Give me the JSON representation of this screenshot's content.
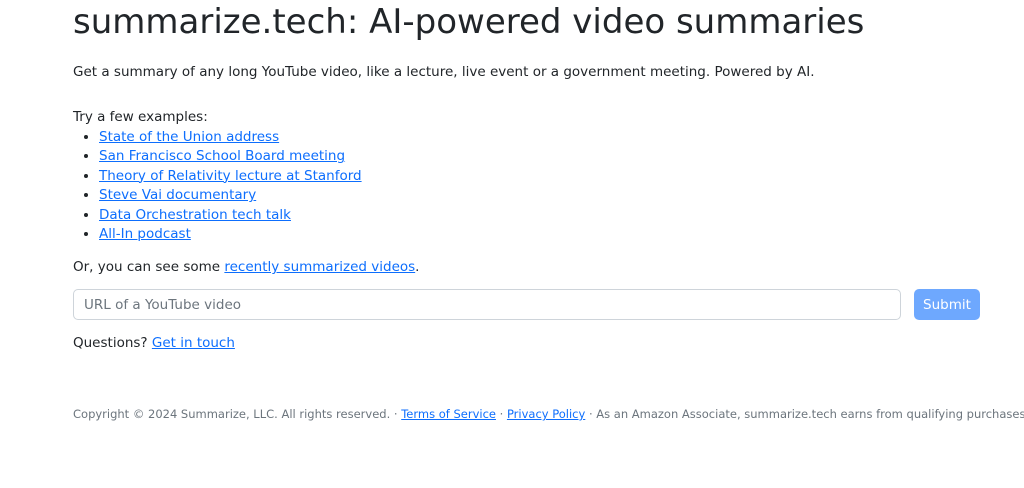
{
  "header": {
    "title": "summarize.tech: AI-powered video summaries"
  },
  "intro": {
    "text": "Get a summary of any long YouTube video, like a lecture, live event or a government meeting. Powered by AI."
  },
  "examples": {
    "heading": "Try a few examples:",
    "items": [
      {
        "label": "State of the Union address"
      },
      {
        "label": "San Francisco School Board meeting"
      },
      {
        "label": "Theory of Relativity lecture at Stanford"
      },
      {
        "label": "Steve Vai documentary"
      },
      {
        "label": "Data Orchestration tech talk"
      },
      {
        "label": "All-In podcast"
      }
    ]
  },
  "recent": {
    "prefix": "Or, you can see some ",
    "link": "recently summarized videos",
    "suffix": "."
  },
  "form": {
    "placeholder": "URL of a YouTube video",
    "value": "",
    "submit_label": "Submit"
  },
  "questions": {
    "prefix": "Questions? ",
    "link": "Get in touch"
  },
  "footer": {
    "copyright": "Copyright © 2024 Summarize, LLC. All rights reserved. · ",
    "terms": "Terms of Service",
    "sep": " · ",
    "privacy": "Privacy Policy",
    "amazon": " · As an Amazon Associate, summarize.tech earns from qualifying purchases."
  },
  "colors": {
    "link": "#0d6efd",
    "submit_bg": "#6ea8fe",
    "text": "#212529",
    "muted": "#6c757d"
  }
}
